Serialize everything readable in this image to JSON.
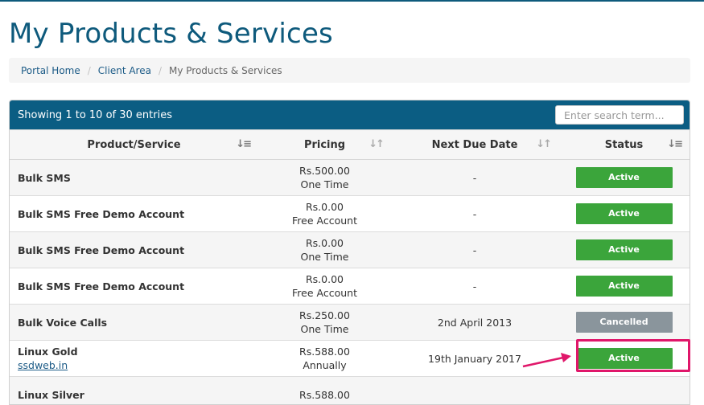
{
  "page": {
    "title": "My Products & Services"
  },
  "breadcrumb": {
    "items": [
      "Portal Home",
      "Client Area"
    ],
    "current": "My Products & Services"
  },
  "table": {
    "info": "Showing 1 to 10 of 30 entries",
    "search_placeholder": "Enter search term...",
    "columns": [
      "Product/Service",
      "Pricing",
      "Next Due Date",
      "Status"
    ],
    "rows": [
      {
        "product": "Bulk SMS",
        "domain": "",
        "price": "Rs.500.00",
        "cycle": "One Time",
        "due": "-",
        "status": "Active"
      },
      {
        "product": "Bulk SMS Free Demo Account",
        "domain": "",
        "price": "Rs.0.00",
        "cycle": "Free Account",
        "due": "-",
        "status": "Active"
      },
      {
        "product": "Bulk SMS Free Demo Account",
        "domain": "",
        "price": "Rs.0.00",
        "cycle": "One Time",
        "due": "-",
        "status": "Active"
      },
      {
        "product": "Bulk SMS Free Demo Account",
        "domain": "",
        "price": "Rs.0.00",
        "cycle": "Free Account",
        "due": "-",
        "status": "Active"
      },
      {
        "product": "Bulk Voice Calls",
        "domain": "",
        "price": "Rs.250.00",
        "cycle": "One Time",
        "due": "2nd April 2013",
        "status": "Cancelled"
      },
      {
        "product": "Linux Gold",
        "domain": "ssdweb.in",
        "price": "Rs.588.00",
        "cycle": "Annually",
        "due": "19th January 2017",
        "status": "Active"
      },
      {
        "product": "Linux Silver",
        "domain": "",
        "price": "Rs.588.00",
        "cycle": "",
        "due": "",
        "status": ""
      }
    ]
  },
  "colors": {
    "brand": "#0e5a7c",
    "active": "#3ba53b",
    "cancelled": "#8a959c",
    "annotation": "#e0176a"
  },
  "icons": {
    "sort": "sort-icon",
    "annotation": "arrow-annotation-icon"
  }
}
